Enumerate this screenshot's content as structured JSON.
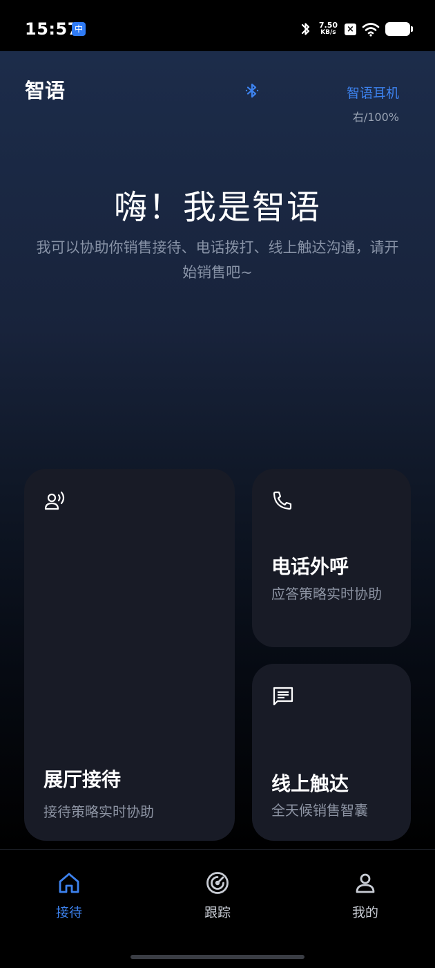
{
  "status_bar": {
    "time": "15:57",
    "app_badge_glyph": "中",
    "net_speed_value": "7.50",
    "net_speed_unit": "KB/s",
    "icons": [
      "bluetooth-icon",
      "sim-off-icon",
      "wifi-icon",
      "battery-icon"
    ]
  },
  "header": {
    "title": "智语",
    "device_name": "智语耳机",
    "device_battery": "右/100%"
  },
  "hero": {
    "title": "嗨！我是智语",
    "subtitle": "我可以协助你销售接待、电话拨打、线上触达沟通，请开始销售吧~"
  },
  "cards": {
    "hall": {
      "title": "展厅接待",
      "desc": "接待策略实时协助",
      "icon": "voice-user-icon"
    },
    "call": {
      "title": "电话外呼",
      "desc": "应答策略实时协助",
      "icon": "phone-icon"
    },
    "online": {
      "title": "线上触达",
      "desc": "全天候销售智囊",
      "icon": "chat-icon"
    }
  },
  "tabs": [
    {
      "label": "接待",
      "icon": "home-icon",
      "active": true
    },
    {
      "label": "跟踪",
      "icon": "radar-icon",
      "active": false
    },
    {
      "label": "我的",
      "icon": "user-icon",
      "active": false
    }
  ],
  "colors": {
    "accent": "#3d82ee",
    "card_bg": "#181b26",
    "secondary_text": "#8c93a2"
  }
}
